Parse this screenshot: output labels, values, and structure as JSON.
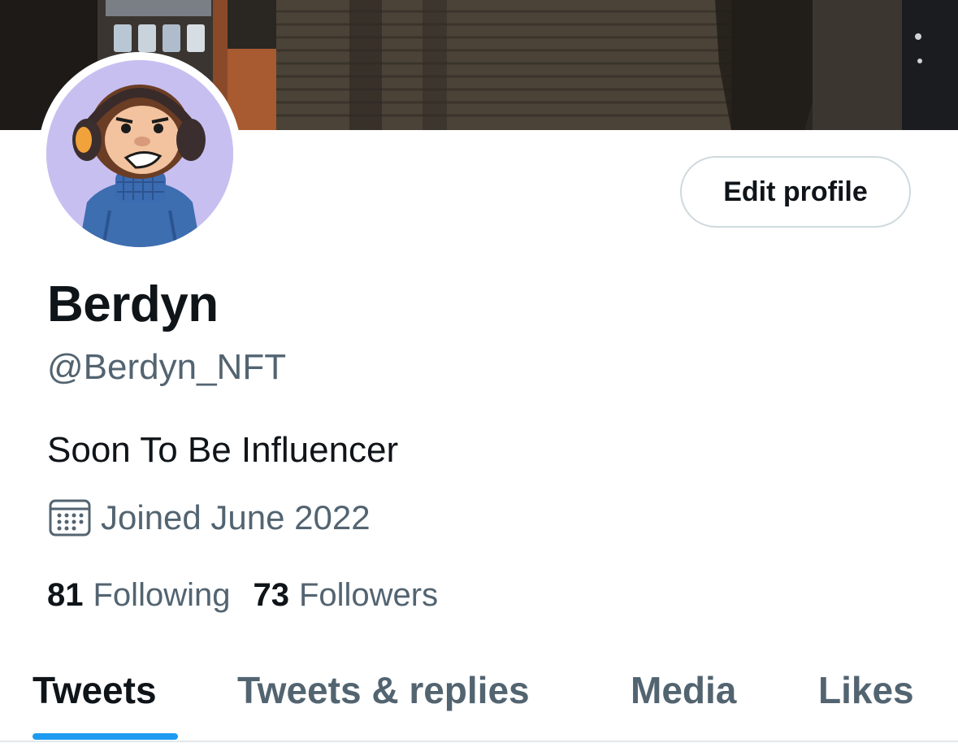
{
  "profile": {
    "display_name": "Berdyn",
    "handle": "@Berdyn_NFT",
    "bio": "Soon To Be Influencer",
    "joined": "Joined June 2022",
    "edit_profile_label": "Edit profile"
  },
  "stats": {
    "following_count": "81",
    "following_label": "Following",
    "followers_count": "73",
    "followers_label": "Followers"
  },
  "tabs": [
    {
      "label": "Tweets",
      "active": true
    },
    {
      "label": "Tweets & replies",
      "active": false
    },
    {
      "label": "Media",
      "active": false
    },
    {
      "label": "Likes",
      "active": false
    }
  ],
  "colors": {
    "accent": "#1d9bf0",
    "text_primary": "#0f1419",
    "text_secondary": "#536471",
    "border": "#cfd9de",
    "avatar_background": "#c8bff1"
  },
  "icons": {
    "calendar": "calendar-icon",
    "avatar": "monkey-with-headphones-avatar"
  }
}
